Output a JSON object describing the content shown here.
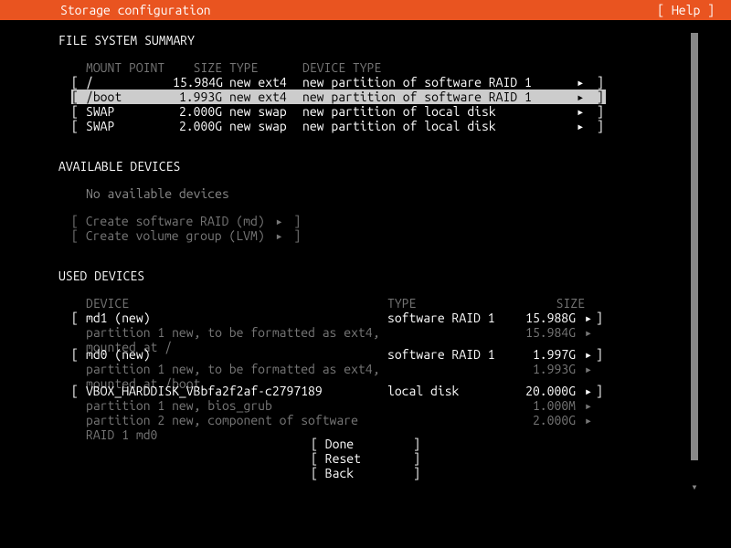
{
  "header": {
    "title": "Storage configuration",
    "help": "[ Help ]"
  },
  "fs_summary": {
    "title": "FILE SYSTEM SUMMARY",
    "cols": {
      "mount": "MOUNT POINT",
      "size": "SIZE",
      "type": "TYPE",
      "devtype": "DEVICE TYPE"
    },
    "rows": [
      {
        "mount": "/",
        "size": "15.984G",
        "type": "new ext4",
        "devtype": "new partition of software RAID 1",
        "selected": false
      },
      {
        "mount": "/boot",
        "size": "1.993G",
        "type": "new ext4",
        "devtype": "new partition of software RAID 1",
        "selected": true
      },
      {
        "mount": "SWAP",
        "size": "2.000G",
        "type": "new swap",
        "devtype": "new partition of local disk",
        "selected": false
      },
      {
        "mount": "SWAP",
        "size": "2.000G",
        "type": "new swap",
        "devtype": "new partition of local disk",
        "selected": false
      }
    ]
  },
  "available": {
    "title": "AVAILABLE DEVICES",
    "none": "No available devices",
    "create_raid": "Create software RAID (md)",
    "create_lvm": "Create volume group (LVM)"
  },
  "used": {
    "title": "USED DEVICES",
    "cols": {
      "device": "DEVICE",
      "type": "TYPE",
      "size": "SIZE"
    },
    "devices": [
      {
        "name": "md1 (new)",
        "type": "software RAID 1",
        "size": "15.988G",
        "parts": [
          {
            "desc": "partition 1  new, to be formatted as ext4, mounted at /",
            "size": "15.984G"
          }
        ]
      },
      {
        "name": "md0 (new)",
        "type": "software RAID 1",
        "size": "1.997G",
        "parts": [
          {
            "desc": "partition 1  new, to be formatted as ext4, mounted at /boot",
            "size": "1.993G"
          }
        ]
      },
      {
        "name": "VBOX_HARDDISK_VBbfa2f2af-c2797189",
        "type": "local disk",
        "size": "20.000G",
        "parts": [
          {
            "desc": "partition 1  new, bios_grub",
            "size": "1.000M"
          },
          {
            "desc": "partition 2  new, component of software RAID 1 md0",
            "size": "2.000G"
          }
        ]
      }
    ]
  },
  "actions": {
    "done": "Done",
    "reset": "Reset",
    "back": "Back"
  },
  "glyphs": {
    "arrow": "▸",
    "down": "▾",
    "lb": "[",
    "rb": "]"
  }
}
